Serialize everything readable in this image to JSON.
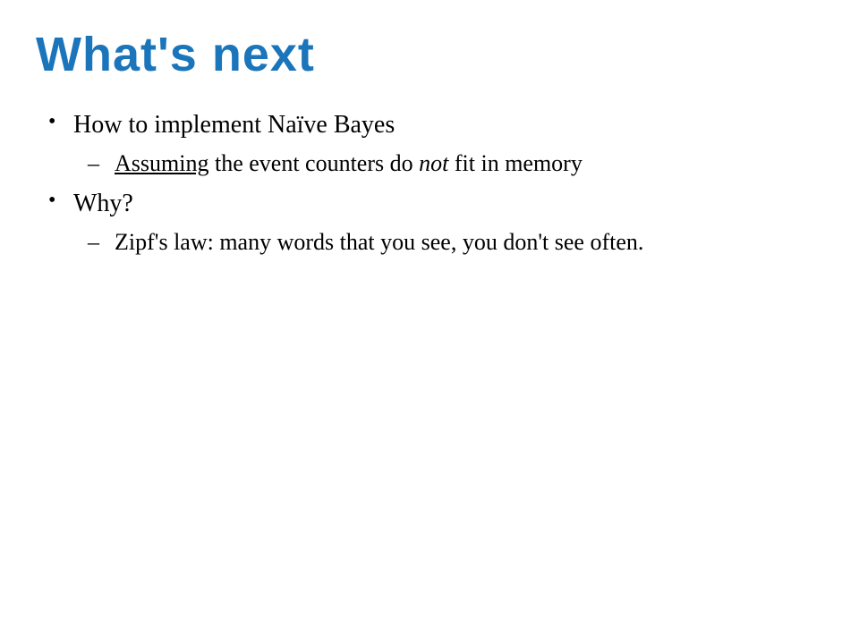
{
  "slide": {
    "title": "What's next",
    "bullets": {
      "item1": {
        "text": "How to implement Naïve Bayes"
      },
      "item1_sub1": {
        "underlined": "Assuming",
        "middle": " the event counters do ",
        "italic": "not",
        "end": " fit in memory"
      },
      "item2": {
        "text": "Why?"
      },
      "item2_sub1": {
        "text": "Zipf's law: many words that you see, you don't see often."
      }
    }
  }
}
